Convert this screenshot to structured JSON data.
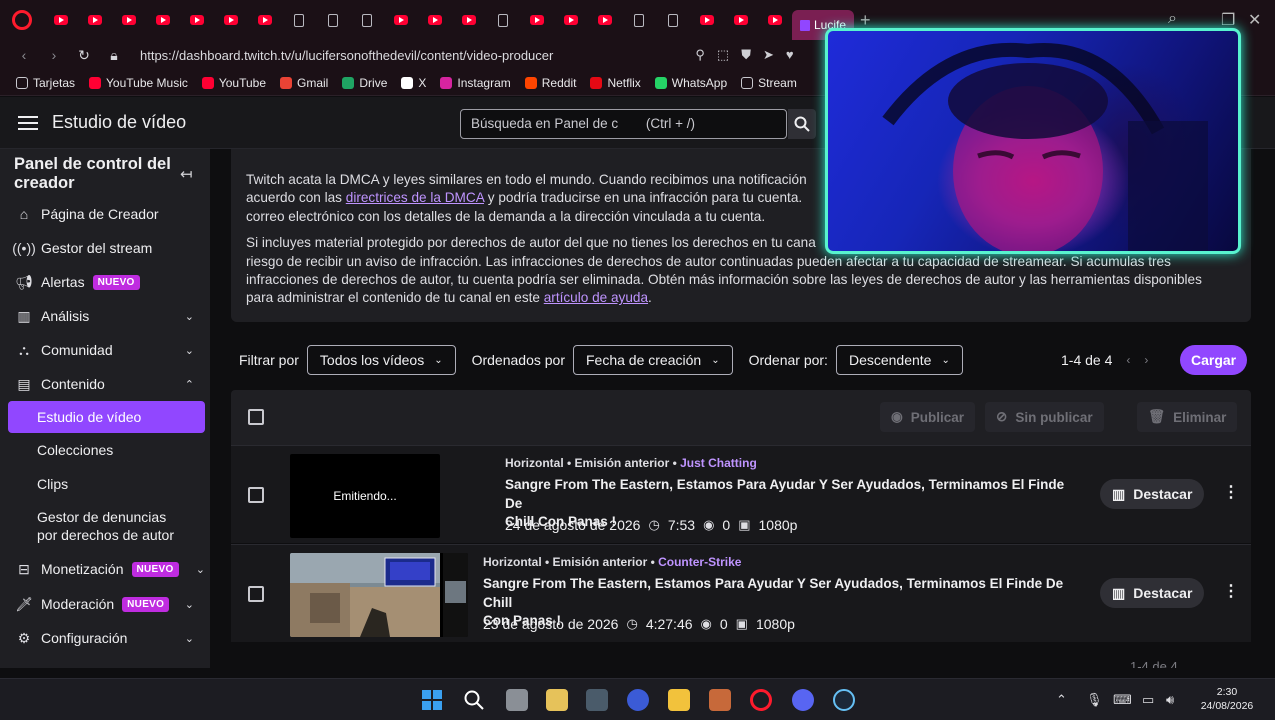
{
  "browser": {
    "active_tab_label": "Lucife",
    "url": "https://dashboard.twitch.tv/u/lucifersonofthedevil/content/video-producer",
    "bookmarks": [
      {
        "label": "Tarjetas",
        "icon": "folder-icon",
        "color": "#c9c9cf"
      },
      {
        "label": "YouTube Music",
        "icon": "youtube-music-icon",
        "color": "#ff0033"
      },
      {
        "label": "YouTube",
        "icon": "youtube-icon",
        "color": "#ff0033"
      },
      {
        "label": "Gmail",
        "icon": "gmail-icon",
        "color": "#ea4335"
      },
      {
        "label": "Drive",
        "icon": "drive-icon",
        "color": "#1fa463"
      },
      {
        "label": "X",
        "icon": "x-icon",
        "color": "#ffffff"
      },
      {
        "label": "Instagram",
        "icon": "instagram-icon",
        "color": "#d6249f"
      },
      {
        "label": "Reddit",
        "icon": "reddit-icon",
        "color": "#ff4500"
      },
      {
        "label": "Netflix",
        "icon": "netflix-icon",
        "color": "#e50914"
      },
      {
        "label": "WhatsApp",
        "icon": "whatsapp-icon",
        "color": "#25d366"
      },
      {
        "label": "Stream",
        "icon": "folder-icon",
        "color": "#c9c9cf"
      }
    ]
  },
  "header": {
    "title": "Estudio de vídeo",
    "search_placeholder": "Búsqueda en Panel de c",
    "search_shortcut": "(Ctrl + /)"
  },
  "sidebar": {
    "heading": "Panel de control del creador",
    "items": [
      {
        "label": "Página de Creador",
        "icon": "home-icon"
      },
      {
        "label": "Gestor del stream",
        "icon": "broadcast-icon"
      },
      {
        "label": "Alertas",
        "icon": "megaphone-icon",
        "badge": "NUEVO"
      },
      {
        "label": "Análisis",
        "icon": "chart-icon"
      },
      {
        "label": "Comunidad",
        "icon": "community-icon"
      },
      {
        "label": "Contenido",
        "icon": "content-icon"
      }
    ],
    "sub_items": [
      "Estudio de vídeo",
      "Colecciones",
      "Clips",
      "Gestor de denuncias",
      "por derechos de autor"
    ],
    "items2": [
      {
        "label": "Monetización",
        "icon": "monetization-icon",
        "badge": "NUEVO"
      },
      {
        "label": "Moderación",
        "icon": "sword-icon",
        "badge": "NUEVO"
      },
      {
        "label": "Configuración",
        "icon": "gear-icon"
      }
    ]
  },
  "notice": {
    "p1_a": "Twitch acata la DMCA y leyes similares en todo el mundo. Cuando recibimos una notificación",
    "p1_b": "acuerdo con las",
    "p1_link": "directrices de la DMCA",
    "p1_c": "y podría traducirse en una infracción para tu cuenta.",
    "p1_d": "correo electrónico con los detalles de la demanda a la dirección vinculada a tu cuenta.",
    "p2_a": "Si incluyes material protegido por derechos de autor del que no tienes los derechos en tu cana",
    "p2_b": "riesgo de recibir un aviso de infracción. Las infracciones de derechos de autor continuadas pueden afectar a tu capacidad de streamear. Si acumulas tres",
    "p2_c": "infracciones de derechos de autor, tu cuenta podría ser eliminada. Obtén más información sobre las leyes de derechos de autor y las herramientas disponibles",
    "p2_d": "para administrar el contenido de tu canal en este",
    "p2_link": "artículo de ayuda",
    "p2_end": "."
  },
  "filters": {
    "filter_label": "Filtrar por",
    "filter_value": "Todos los vídeos",
    "sort_label": "Ordenados por",
    "sort_value": "Fecha de creación",
    "order_label": "Ordenar por:",
    "order_value": "Descendente",
    "range": "1-4 de 4",
    "upload_button": "Cargar"
  },
  "table_actions": {
    "publish": "Publicar",
    "unpublish": "Sin publicar",
    "delete": "Eliminar"
  },
  "videos": [
    {
      "thumb_text": "Emitiendo...",
      "format": "Horizontal",
      "type": "Emisión anterior",
      "category": "Just Chatting",
      "title_l1": "Sangre From The Eastern, Estamos Para Ayudar Y Ser Ayudados, Terminamos El Finde De",
      "title_l2": "Chill Con Panas !",
      "date": "24 de agosto de 2026",
      "duration": "7:53",
      "views": "0",
      "quality": "1080p",
      "action": "Destacar"
    },
    {
      "thumb_text": "",
      "format": "Horizontal",
      "type": "Emisión anterior",
      "category": "Counter-Strike",
      "title_l1": "Sangre From The Eastern, Estamos Para Ayudar Y Ser Ayudados, Terminamos El Finde De Chill",
      "title_l2": "Con Panas !",
      "date": "23 de agosto de 2026",
      "duration": "4:27:46",
      "views": "0",
      "quality": "1080p",
      "action": "Destacar"
    }
  ],
  "footer_range": "1-4 de 4",
  "taskbar": {
    "time": "2:30",
    "date": "24/08/2026"
  },
  "colors": {
    "accent": "#9147ff",
    "badge": "#bf2ce0",
    "link": "#bf94ff",
    "webcam_border": "#58f3cf"
  }
}
